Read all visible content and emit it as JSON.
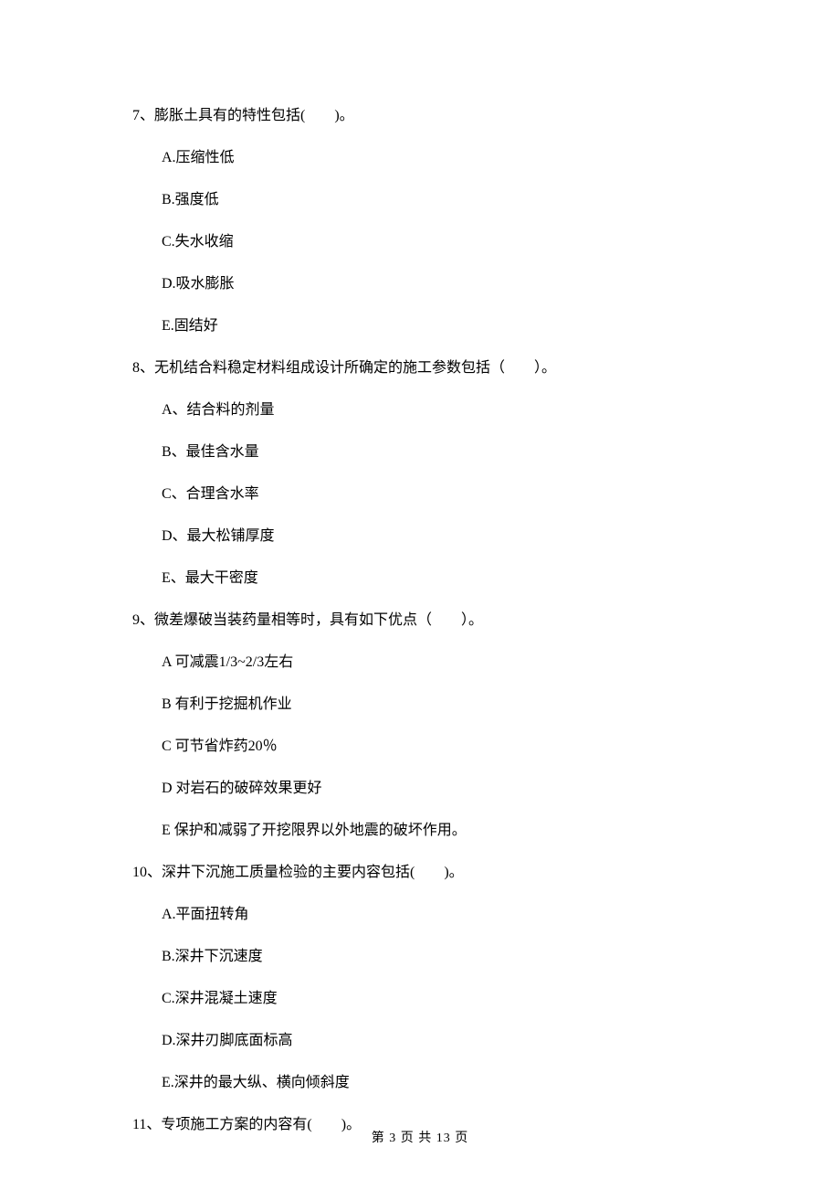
{
  "questions": [
    {
      "number": "7",
      "stem": "7、膨胀土具有的特性包括(　　)。",
      "options": [
        "A.压缩性低",
        "B.强度低",
        "C.失水收缩",
        "D.吸水膨胀",
        "E.固结好"
      ]
    },
    {
      "number": "8",
      "stem": "8、无机结合料稳定材料组成设计所确定的施工参数包括（　　）。",
      "options": [
        "A、结合料的剂量",
        "B、最佳含水量",
        "C、合理含水率",
        "D、最大松铺厚度",
        "E、最大干密度"
      ]
    },
    {
      "number": "9",
      "stem": "9、微差爆破当装药量相等时，具有如下优点（　　）。",
      "options": [
        "A 可减震1/3~2/3左右",
        "B 有利于挖掘机作业",
        "C 可节省炸药20％",
        "D 对岩石的破碎效果更好",
        "E 保护和减弱了开挖限界以外地震的破坏作用。"
      ]
    },
    {
      "number": "10",
      "stem": "10、深井下沉施工质量检验的主要内容包括(　　)。",
      "options": [
        "A.平面扭转角",
        "B.深井下沉速度",
        "C.深井混凝土速度",
        "D.深井刃脚底面标高",
        "E.深井的最大纵、横向倾斜度"
      ]
    },
    {
      "number": "11",
      "stem": "11、专项施工方案的内容有(　　)。",
      "options": []
    }
  ],
  "footer": "第 3 页 共 13 页"
}
